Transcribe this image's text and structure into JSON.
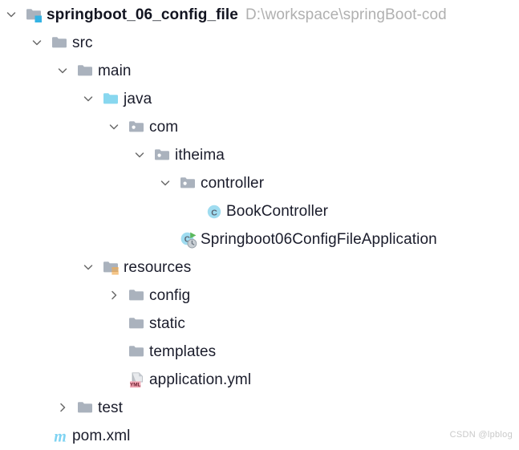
{
  "project": {
    "name": "springboot_06_config_file",
    "path": "D:\\workspace\\springBoot-cod",
    "watermark": "CSDN @lpblog"
  },
  "colors": {
    "folder_grey": "#aab2bd",
    "folder_blue": "#88d7ef",
    "module_badge": "#34b3e4",
    "resource_badge": "#f0ab52",
    "class_circle": "#9fdcf0",
    "class_letter": "#5a6472",
    "maven_m": "#7fd3f2",
    "yml_badge": "#f4a7b5",
    "text": "#1a1c2b",
    "path_text": "#b0b0b0",
    "chevron": "#6a6a6a",
    "run_green": "#4caf50"
  },
  "tree": [
    {
      "id": "springboot_06_config_file",
      "label": "springboot_06_config_file",
      "suffix": "D:\\workspace\\springBoot-cod",
      "icon": "module-folder-icon",
      "state": "expanded",
      "depth": 0,
      "bold": true
    },
    {
      "id": "src",
      "label": "src",
      "suffix": "",
      "icon": "folder-icon",
      "state": "expanded",
      "depth": 1,
      "bold": false
    },
    {
      "id": "main",
      "label": "main",
      "suffix": "",
      "icon": "folder-icon",
      "state": "expanded",
      "depth": 2,
      "bold": false
    },
    {
      "id": "java",
      "label": "java",
      "suffix": "",
      "icon": "source-folder-icon",
      "state": "expanded",
      "depth": 3,
      "bold": false
    },
    {
      "id": "com",
      "label": "com",
      "suffix": "",
      "icon": "package-icon",
      "state": "expanded",
      "depth": 4,
      "bold": false
    },
    {
      "id": "itheima",
      "label": "itheima",
      "suffix": "",
      "icon": "package-icon",
      "state": "expanded",
      "depth": 5,
      "bold": false
    },
    {
      "id": "controller",
      "label": "controller",
      "suffix": "",
      "icon": "package-icon",
      "state": "expanded",
      "depth": 6,
      "bold": false
    },
    {
      "id": "BookController",
      "label": "BookController",
      "suffix": "",
      "icon": "java-class-icon",
      "state": "leaf",
      "depth": 7,
      "bold": false
    },
    {
      "id": "Springboot06ConfigFileApplication",
      "label": "Springboot06ConfigFileApplication",
      "suffix": "",
      "icon": "spring-boot-main-class-icon",
      "state": "leaf",
      "depth": 6,
      "bold": false
    },
    {
      "id": "resources",
      "label": "resources",
      "suffix": "",
      "icon": "resource-folder-icon",
      "state": "expanded",
      "depth": 3,
      "bold": false
    },
    {
      "id": "config",
      "label": "config",
      "suffix": "",
      "icon": "folder-icon",
      "state": "collapsed",
      "depth": 4,
      "bold": false
    },
    {
      "id": "static",
      "label": "static",
      "suffix": "",
      "icon": "folder-icon",
      "state": "leaf",
      "depth": 4,
      "bold": false
    },
    {
      "id": "templates",
      "label": "templates",
      "suffix": "",
      "icon": "folder-icon",
      "state": "leaf",
      "depth": 4,
      "bold": false
    },
    {
      "id": "application.yml",
      "label": "application.yml",
      "suffix": "",
      "icon": "yml-file-icon",
      "state": "leaf",
      "depth": 4,
      "bold": false
    },
    {
      "id": "test",
      "label": "test",
      "suffix": "",
      "icon": "folder-icon",
      "state": "collapsed",
      "depth": 2,
      "bold": false
    },
    {
      "id": "pom.xml",
      "label": "pom.xml",
      "suffix": "",
      "icon": "maven-file-icon",
      "state": "leaf",
      "depth": 1,
      "bold": false
    }
  ]
}
